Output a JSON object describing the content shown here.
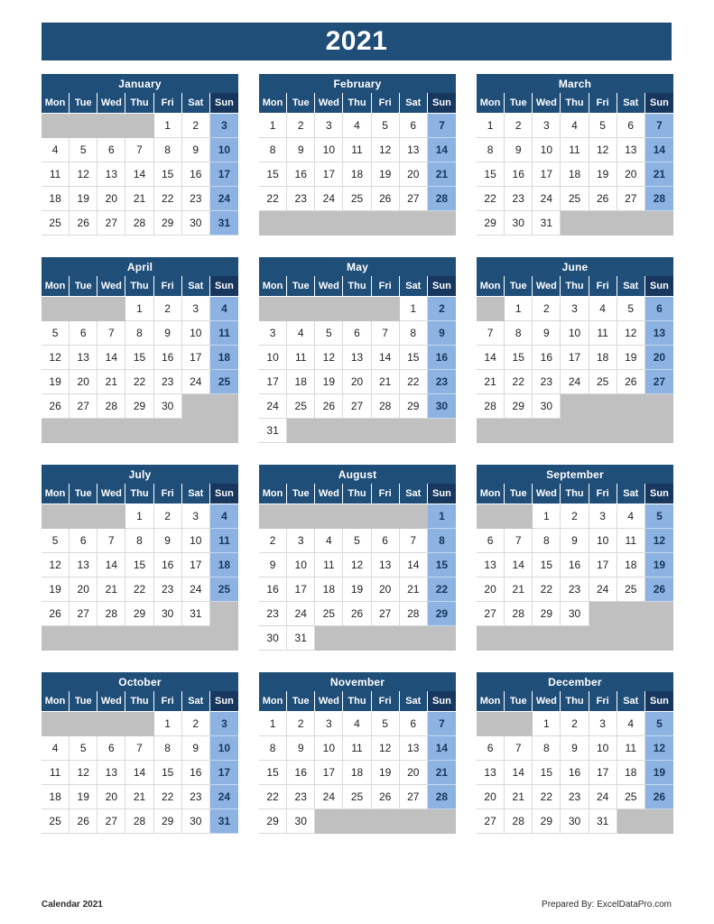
{
  "title": {
    "year": "2021"
  },
  "colors": {
    "header_blue": "#1f4e79",
    "sunday_header_blue": "#17375e",
    "sunday_cell_blue": "#8db3e2",
    "sunday_text": "#16365c",
    "empty_gray": "#c0c0c0",
    "cell_border": "#d9d9d9",
    "page_background": "#ffffff"
  },
  "weekdays": [
    "Mon",
    "Tue",
    "Wed",
    "Thu",
    "Fri",
    "Sat",
    "Sun"
  ],
  "months": [
    {
      "name": "January",
      "weeks": [
        [
          "",
          "",
          "",
          "",
          "1",
          "2",
          "3"
        ],
        [
          "4",
          "5",
          "6",
          "7",
          "8",
          "9",
          "10"
        ],
        [
          "11",
          "12",
          "13",
          "14",
          "15",
          "16",
          "17"
        ],
        [
          "18",
          "19",
          "20",
          "21",
          "22",
          "23",
          "24"
        ],
        [
          "25",
          "26",
          "27",
          "28",
          "29",
          "30",
          "31"
        ]
      ]
    },
    {
      "name": "February",
      "weeks": [
        [
          "1",
          "2",
          "3",
          "4",
          "5",
          "6",
          "7"
        ],
        [
          "8",
          "9",
          "10",
          "11",
          "12",
          "13",
          "14"
        ],
        [
          "15",
          "16",
          "17",
          "18",
          "19",
          "20",
          "21"
        ],
        [
          "22",
          "23",
          "24",
          "25",
          "26",
          "27",
          "28"
        ],
        [
          "",
          "",
          "",
          "",
          "",
          "",
          ""
        ]
      ]
    },
    {
      "name": "March",
      "weeks": [
        [
          "1",
          "2",
          "3",
          "4",
          "5",
          "6",
          "7"
        ],
        [
          "8",
          "9",
          "10",
          "11",
          "12",
          "13",
          "14"
        ],
        [
          "15",
          "16",
          "17",
          "18",
          "19",
          "20",
          "21"
        ],
        [
          "22",
          "23",
          "24",
          "25",
          "26",
          "27",
          "28"
        ],
        [
          "29",
          "30",
          "31",
          "",
          "",
          "",
          ""
        ]
      ]
    },
    {
      "name": "April",
      "weeks": [
        [
          "",
          "",
          "",
          "1",
          "2",
          "3",
          "4"
        ],
        [
          "5",
          "6",
          "7",
          "8",
          "9",
          "10",
          "11"
        ],
        [
          "12",
          "13",
          "14",
          "15",
          "16",
          "17",
          "18"
        ],
        [
          "19",
          "20",
          "21",
          "22",
          "23",
          "24",
          "25"
        ],
        [
          "26",
          "27",
          "28",
          "29",
          "30",
          "",
          ""
        ],
        [
          "",
          "",
          "",
          "",
          "",
          "",
          ""
        ]
      ]
    },
    {
      "name": "May",
      "weeks": [
        [
          "",
          "",
          "",
          "",
          "",
          "1",
          "2"
        ],
        [
          "3",
          "4",
          "5",
          "6",
          "7",
          "8",
          "9"
        ],
        [
          "10",
          "11",
          "12",
          "13",
          "14",
          "15",
          "16"
        ],
        [
          "17",
          "18",
          "19",
          "20",
          "21",
          "22",
          "23"
        ],
        [
          "24",
          "25",
          "26",
          "27",
          "28",
          "29",
          "30"
        ],
        [
          "31",
          "",
          "",
          "",
          "",
          "",
          ""
        ]
      ]
    },
    {
      "name": "June",
      "weeks": [
        [
          "",
          "1",
          "2",
          "3",
          "4",
          "5",
          "6"
        ],
        [
          "7",
          "8",
          "9",
          "10",
          "11",
          "12",
          "13"
        ],
        [
          "14",
          "15",
          "16",
          "17",
          "18",
          "19",
          "20"
        ],
        [
          "21",
          "22",
          "23",
          "24",
          "25",
          "26",
          "27"
        ],
        [
          "28",
          "29",
          "30",
          "",
          "",
          "",
          ""
        ],
        [
          "",
          "",
          "",
          "",
          "",
          "",
          ""
        ]
      ]
    },
    {
      "name": "July",
      "weeks": [
        [
          "",
          "",
          "",
          "1",
          "2",
          "3",
          "4"
        ],
        [
          "5",
          "6",
          "7",
          "8",
          "9",
          "10",
          "11"
        ],
        [
          "12",
          "13",
          "14",
          "15",
          "16",
          "17",
          "18"
        ],
        [
          "19",
          "20",
          "21",
          "22",
          "23",
          "24",
          "25"
        ],
        [
          "26",
          "27",
          "28",
          "29",
          "30",
          "31",
          ""
        ],
        [
          "",
          "",
          "",
          "",
          "",
          "",
          ""
        ]
      ]
    },
    {
      "name": "August",
      "weeks": [
        [
          "",
          "",
          "",
          "",
          "",
          "",
          "1"
        ],
        [
          "2",
          "3",
          "4",
          "5",
          "6",
          "7",
          "8"
        ],
        [
          "9",
          "10",
          "11",
          "12",
          "13",
          "14",
          "15"
        ],
        [
          "16",
          "17",
          "18",
          "19",
          "20",
          "21",
          "22"
        ],
        [
          "23",
          "24",
          "25",
          "26",
          "27",
          "28",
          "29"
        ],
        [
          "30",
          "31",
          "",
          "",
          "",
          "",
          ""
        ]
      ]
    },
    {
      "name": "September",
      "weeks": [
        [
          "",
          "",
          "1",
          "2",
          "3",
          "4",
          "5"
        ],
        [
          "6",
          "7",
          "8",
          "9",
          "10",
          "11",
          "12"
        ],
        [
          "13",
          "14",
          "15",
          "16",
          "17",
          "18",
          "19"
        ],
        [
          "20",
          "21",
          "22",
          "23",
          "24",
          "25",
          "26"
        ],
        [
          "27",
          "28",
          "29",
          "30",
          "",
          "",
          ""
        ],
        [
          "",
          "",
          "",
          "",
          "",
          "",
          ""
        ]
      ]
    },
    {
      "name": "October",
      "weeks": [
        [
          "",
          "",
          "",
          "",
          "1",
          "2",
          "3"
        ],
        [
          "4",
          "5",
          "6",
          "7",
          "8",
          "9",
          "10"
        ],
        [
          "11",
          "12",
          "13",
          "14",
          "15",
          "16",
          "17"
        ],
        [
          "18",
          "19",
          "20",
          "21",
          "22",
          "23",
          "24"
        ],
        [
          "25",
          "26",
          "27",
          "28",
          "29",
          "30",
          "31"
        ]
      ]
    },
    {
      "name": "November",
      "weeks": [
        [
          "1",
          "2",
          "3",
          "4",
          "5",
          "6",
          "7"
        ],
        [
          "8",
          "9",
          "10",
          "11",
          "12",
          "13",
          "14"
        ],
        [
          "15",
          "16",
          "17",
          "18",
          "19",
          "20",
          "21"
        ],
        [
          "22",
          "23",
          "24",
          "25",
          "26",
          "27",
          "28"
        ],
        [
          "29",
          "30",
          "",
          "",
          "",
          "",
          ""
        ]
      ]
    },
    {
      "name": "December",
      "weeks": [
        [
          "",
          "",
          "1",
          "2",
          "3",
          "4",
          "5"
        ],
        [
          "6",
          "7",
          "8",
          "9",
          "10",
          "11",
          "12"
        ],
        [
          "13",
          "14",
          "15",
          "16",
          "17",
          "18",
          "19"
        ],
        [
          "20",
          "21",
          "22",
          "23",
          "24",
          "25",
          "26"
        ],
        [
          "27",
          "28",
          "29",
          "30",
          "31",
          "",
          ""
        ]
      ]
    }
  ],
  "footer": {
    "left": "Calendar 2021",
    "right": "Prepared By: ExcelDataPro.com"
  }
}
